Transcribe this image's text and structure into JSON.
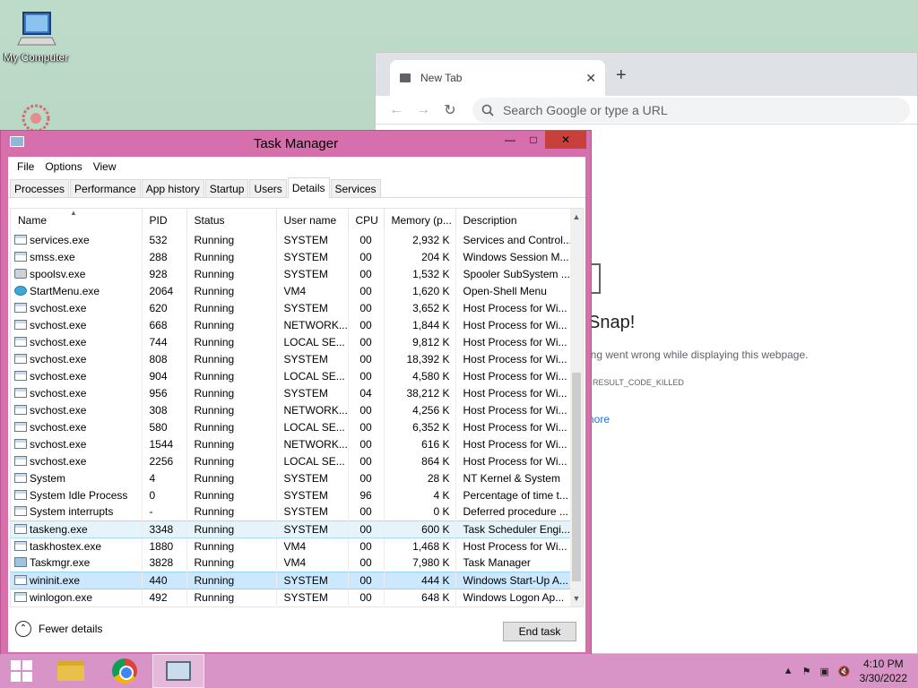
{
  "desktop": {
    "icons": [
      {
        "label": "My Computer"
      }
    ]
  },
  "chrome": {
    "tab_title": "New Tab",
    "close_glyph": "✕",
    "new_tab_glyph": "+",
    "omnibox_placeholder": "Search Google or type a URL",
    "error": {
      "title": "Snap!",
      "description": "ing went wrong while displaying this webpage.",
      "code": ": RESULT_CODE_KILLED",
      "more": "nore"
    }
  },
  "taskmgr": {
    "title": "Task Manager",
    "menu": [
      "File",
      "Options",
      "View"
    ],
    "tabs": [
      "Processes",
      "Performance",
      "App history",
      "Startup",
      "Users",
      "Details",
      "Services"
    ],
    "active_tab": "Details",
    "columns": [
      "Name",
      "PID",
      "Status",
      "User name",
      "CPU",
      "Memory (p...",
      "Description"
    ],
    "rows": [
      {
        "name": "services.exe",
        "pid": "532",
        "status": "Running",
        "user": "SYSTEM",
        "cpu": "00",
        "mem": "2,932 K",
        "desc": "Services and Control..."
      },
      {
        "name": "smss.exe",
        "pid": "288",
        "status": "Running",
        "user": "SYSTEM",
        "cpu": "00",
        "mem": "204 K",
        "desc": "Windows Session M..."
      },
      {
        "name": "spoolsv.exe",
        "pid": "928",
        "status": "Running",
        "user": "SYSTEM",
        "cpu": "00",
        "mem": "1,532 K",
        "desc": "Spooler SubSystem ..."
      },
      {
        "name": "StartMenu.exe",
        "pid": "2064",
        "status": "Running",
        "user": "VM4",
        "cpu": "00",
        "mem": "1,620 K",
        "desc": "Open-Shell Menu"
      },
      {
        "name": "svchost.exe",
        "pid": "620",
        "status": "Running",
        "user": "SYSTEM",
        "cpu": "00",
        "mem": "3,652 K",
        "desc": "Host Process for Wi..."
      },
      {
        "name": "svchost.exe",
        "pid": "668",
        "status": "Running",
        "user": "NETWORK...",
        "cpu": "00",
        "mem": "1,844 K",
        "desc": "Host Process for Wi..."
      },
      {
        "name": "svchost.exe",
        "pid": "744",
        "status": "Running",
        "user": "LOCAL SE...",
        "cpu": "00",
        "mem": "9,812 K",
        "desc": "Host Process for Wi..."
      },
      {
        "name": "svchost.exe",
        "pid": "808",
        "status": "Running",
        "user": "SYSTEM",
        "cpu": "00",
        "mem": "18,392 K",
        "desc": "Host Process for Wi..."
      },
      {
        "name": "svchost.exe",
        "pid": "904",
        "status": "Running",
        "user": "LOCAL SE...",
        "cpu": "00",
        "mem": "4,580 K",
        "desc": "Host Process for Wi..."
      },
      {
        "name": "svchost.exe",
        "pid": "956",
        "status": "Running",
        "user": "SYSTEM",
        "cpu": "04",
        "mem": "38,212 K",
        "desc": "Host Process for Wi..."
      },
      {
        "name": "svchost.exe",
        "pid": "308",
        "status": "Running",
        "user": "NETWORK...",
        "cpu": "00",
        "mem": "4,256 K",
        "desc": "Host Process for Wi..."
      },
      {
        "name": "svchost.exe",
        "pid": "580",
        "status": "Running",
        "user": "LOCAL SE...",
        "cpu": "00",
        "mem": "6,352 K",
        "desc": "Host Process for Wi..."
      },
      {
        "name": "svchost.exe",
        "pid": "1544",
        "status": "Running",
        "user": "NETWORK...",
        "cpu": "00",
        "mem": "616 K",
        "desc": "Host Process for Wi..."
      },
      {
        "name": "svchost.exe",
        "pid": "2256",
        "status": "Running",
        "user": "LOCAL SE...",
        "cpu": "00",
        "mem": "864 K",
        "desc": "Host Process for Wi..."
      },
      {
        "name": "System",
        "pid": "4",
        "status": "Running",
        "user": "SYSTEM",
        "cpu": "00",
        "mem": "28 K",
        "desc": "NT Kernel & System"
      },
      {
        "name": "System Idle Process",
        "pid": "0",
        "status": "Running",
        "user": "SYSTEM",
        "cpu": "96",
        "mem": "4 K",
        "desc": "Percentage of time t..."
      },
      {
        "name": "System interrupts",
        "pid": "-",
        "status": "Running",
        "user": "SYSTEM",
        "cpu": "00",
        "mem": "0 K",
        "desc": "Deferred procedure ..."
      },
      {
        "name": "taskeng.exe",
        "pid": "3348",
        "status": "Running",
        "user": "SYSTEM",
        "cpu": "00",
        "mem": "600 K",
        "desc": "Task Scheduler Engi..."
      },
      {
        "name": "taskhostex.exe",
        "pid": "1880",
        "status": "Running",
        "user": "VM4",
        "cpu": "00",
        "mem": "1,468 K",
        "desc": "Host Process for Wi..."
      },
      {
        "name": "Taskmgr.exe",
        "pid": "3828",
        "status": "Running",
        "user": "VM4",
        "cpu": "00",
        "mem": "7,980 K",
        "desc": "Task Manager"
      },
      {
        "name": "wininit.exe",
        "pid": "440",
        "status": "Running",
        "user": "SYSTEM",
        "cpu": "00",
        "mem": "444 K",
        "desc": "Windows Start-Up A..."
      },
      {
        "name": "winlogon.exe",
        "pid": "492",
        "status": "Running",
        "user": "SYSTEM",
        "cpu": "00",
        "mem": "648 K",
        "desc": "Windows Logon Ap..."
      }
    ],
    "highlighted_row": "taskeng.exe",
    "selected_row": "wininit.exe",
    "fewer_details": "Fewer details",
    "end_task": "End task"
  },
  "taskbar": {
    "clock_time": "4:10 PM",
    "clock_date": "3/30/2022"
  },
  "colors": {
    "window_border": "#d86fad",
    "close_button": "#c7403a",
    "taskbar": "#d894c6",
    "selection": "#cce8ff"
  }
}
